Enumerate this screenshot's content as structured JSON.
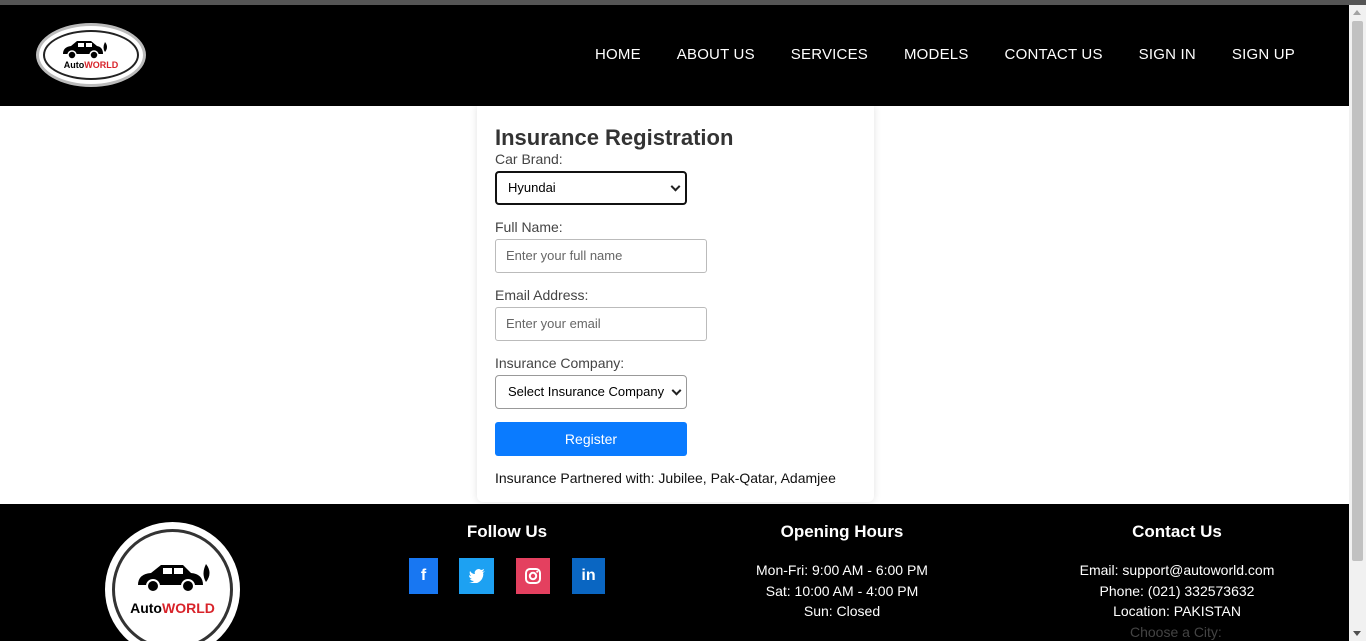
{
  "header": {
    "logo": {
      "word1": "Auto",
      "word2": "WORLD"
    },
    "nav": [
      "HOME",
      "ABOUT US",
      "SERVICES",
      "MODELS",
      "CONTACT US",
      "SIGN IN",
      "SIGN UP"
    ]
  },
  "form": {
    "title": "Insurance Registration",
    "car_brand_label": "Car Brand:",
    "car_brand_value": "Hyundai",
    "full_name_label": "Full Name:",
    "full_name_placeholder": "Enter your full name",
    "email_label": "Email Address:",
    "email_placeholder": "Enter your email",
    "insurance_label": "Insurance Company:",
    "insurance_value": "Select Insurance Company",
    "register_label": "Register",
    "partners_text": "Insurance Partnered with: Jubilee, Pak-Qatar, Adamjee"
  },
  "footer": {
    "logo": {
      "word1": "Auto",
      "word2": "WORLD"
    },
    "follow_title": "Follow Us",
    "social": [
      "facebook-icon",
      "twitter-icon",
      "instagram-icon",
      "linkedin-icon"
    ],
    "hours_title": "Opening Hours",
    "hours": [
      "Mon-Fri: 9:00 AM - 6:00 PM",
      "Sat: 10:00 AM - 4:00 PM",
      "Sun: Closed"
    ],
    "contact_title": "Contact Us",
    "contact": [
      "Email: support@autoworld.com",
      "Phone: (021) 332573632",
      "Location: PAKISTAN"
    ],
    "city_hint": "Choose a City:"
  },
  "colors": {
    "header_bg": "#000000",
    "button_blue": "#0a7bff",
    "brand_red": "#d8232a"
  }
}
